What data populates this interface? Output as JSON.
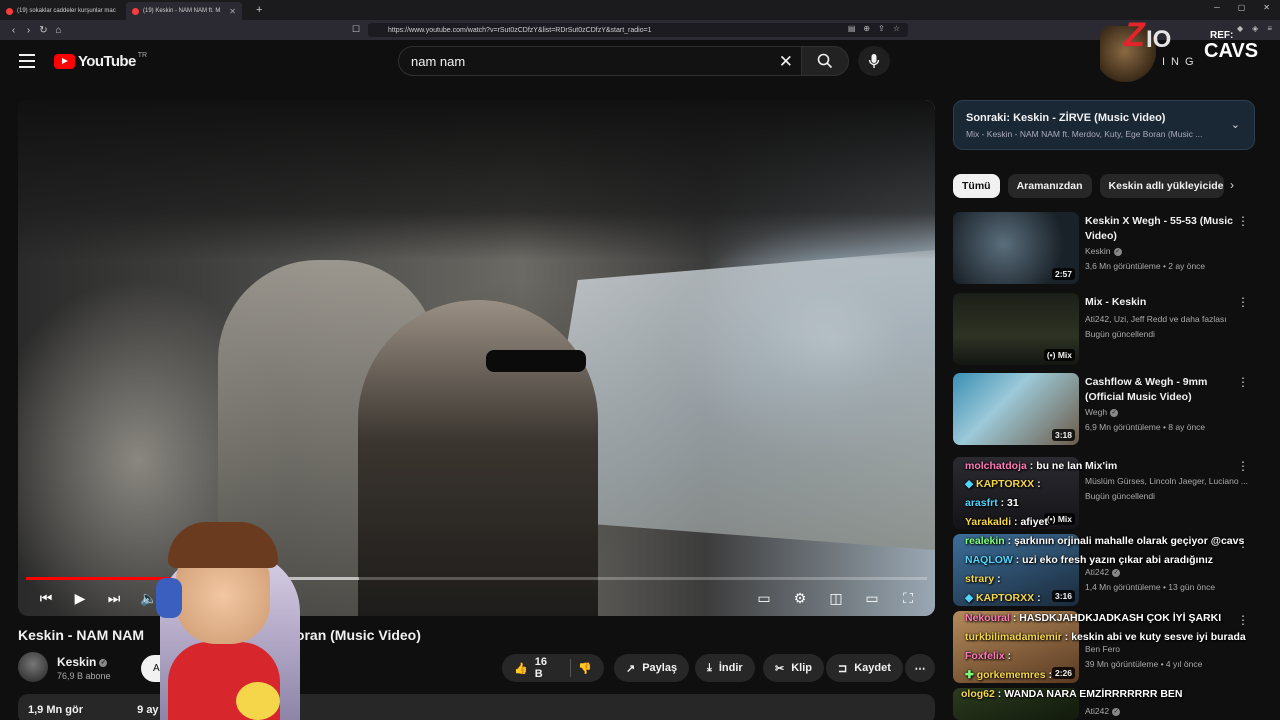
{
  "browser": {
    "tabs": [
      {
        "title": "(19) sokaklar caddeler kurşunlar mac"
      },
      {
        "title": "(19) Keskin - NAM NAM ft. M"
      }
    ],
    "new_tab": "+",
    "url": "https://www.youtube.com/watch?v=rSut0zCDfzY&list=RDrSut0zCDfzY&start_radio=1"
  },
  "header": {
    "logo_text": "YouTube",
    "country": "TR",
    "search_value": "nam nam"
  },
  "player": {
    "progress_played": 0.17,
    "progress_buffered": 0.37
  },
  "video": {
    "title_left": "Keskin - NAM NAM",
    "title_right": "Boran (Music Video)",
    "channel": "Keskin",
    "subs": "76,9 B abone",
    "subscribe": "Abon",
    "likes": "16 B",
    "share": "Paylaş",
    "download": "İndir",
    "clip": "Klip",
    "save": "Kaydet",
    "desc_views": "1,9 Mn gör",
    "desc_time": "9 ay ön"
  },
  "sidebar": {
    "upnext_title": "Sonraki: Keskin - ZİRVE (Music Video)",
    "upnext_sub": "Mix - Keskin - NAM NAM ft. Merdov, Kuty, Ege Boran (Music ...",
    "chips": [
      "Tümü",
      "Aramanızdan",
      "Keskin adlı yükleyiciden"
    ],
    "recs": [
      {
        "title": "Keskin X Wegh - 55-53 (Music Video)",
        "channel": "Keskin",
        "meta": "3,6 Mn görüntüleme • 2 ay önce",
        "duration": "2:57"
      },
      {
        "title": "Mix - Keskin",
        "channel": "Ati242, Uzi, Jeff Redd ve daha fazlası",
        "meta": "Bugün güncellendi",
        "duration": "Mix"
      },
      {
        "title": "Cashflow & Wegh - 9mm (Official Music Video)",
        "channel": "Wegh",
        "meta": "6,9 Mn görüntüleme • 8 ay önce",
        "duration": "3:18"
      },
      {
        "title": "Mix'im",
        "channel": "Müslüm Gürses, Lincoln Jaeger, Luciano ...",
        "meta": "Bugün güncellendi",
        "duration": "Mix"
      },
      {
        "title": "",
        "channel": "Ati242",
        "meta": "1,4 Mn görüntüleme • 13 gün önce",
        "duration": "3:16"
      },
      {
        "title": "",
        "channel": "Ben Fero",
        "meta": "39 Mn görüntüleme • 4 yıl önce",
        "duration": "2:26"
      },
      {
        "title": "",
        "channel": "Ati242",
        "meta": "",
        "duration": ""
      }
    ]
  },
  "overlay": {
    "brand_z": "Z",
    "brand_io": "IO",
    "brand_ref": "REF:",
    "brand_cavs": "CAVS",
    "brand_ing": "ING",
    "chat": [
      {
        "user": "molchatdoja",
        "msg": "bu ne lan"
      },
      {
        "user": "KAPTORXX",
        "msg": ""
      },
      {
        "user": "arasfrt",
        "msg": "31"
      },
      {
        "user": "Yarakaldi",
        "msg": "afiyet"
      },
      {
        "user": "realekin",
        "msg": "şarkının orjinali mahalle olarak geçiyor @cavs"
      },
      {
        "user": "NAQLOW",
        "msg": "uzi eko fresh yazın çıkar abi aradığınız"
      },
      {
        "user": "strary",
        "msg": ""
      },
      {
        "user": "KAPTORXX",
        "msg": ""
      },
      {
        "user": "Nekoural",
        "msg": "HASDKJAHDKJADKASH ÇOK İYİ ŞARKI"
      },
      {
        "user": "turkbilimadamiemir",
        "msg": "keskin abi ve kuty sesve iyi burada"
      },
      {
        "user": "Foxfelix",
        "msg": ""
      },
      {
        "user": "gorkememres",
        "msg": ""
      },
      {
        "user": "olog62",
        "msg": "WANDA NARA EMZİRRRRRRR BEN"
      }
    ],
    "colors": {
      "youtube_red": "#ff0000",
      "brand_red": "#e4232a",
      "chat_user_yellow": "#f5d64a",
      "chat_user_pink": "#ff7ab8",
      "chat_user_cyan": "#4fd6ff",
      "chat_user_green": "#7dff7d"
    }
  }
}
